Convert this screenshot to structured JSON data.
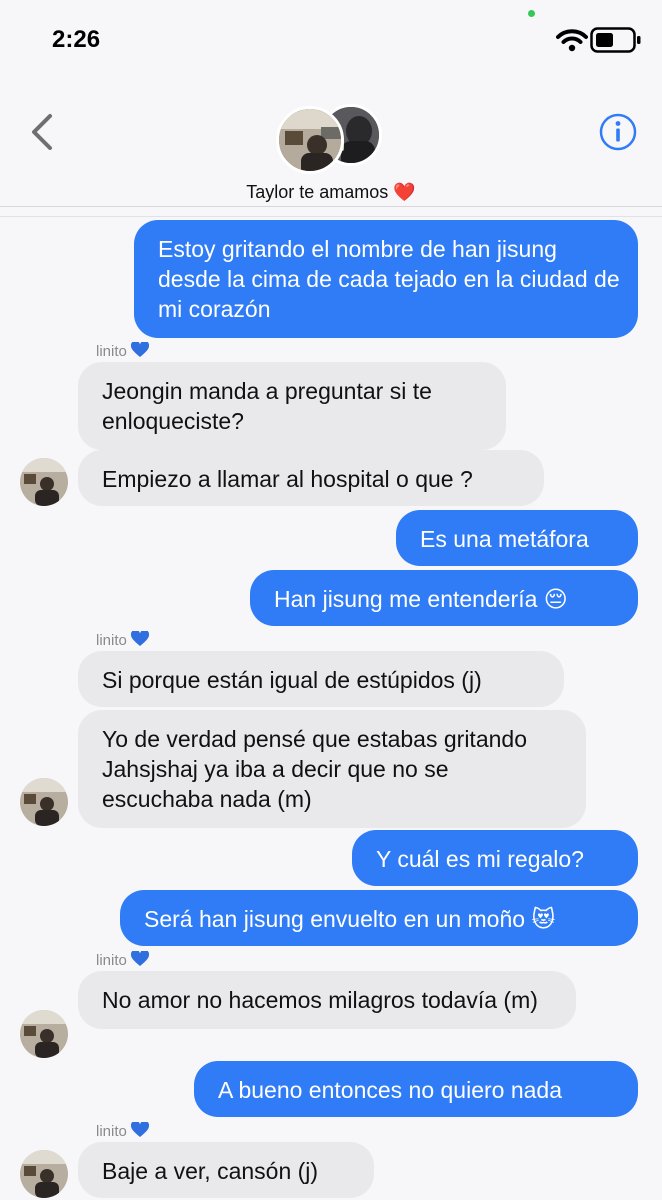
{
  "status_bar": {
    "time": "2:26"
  },
  "header": {
    "contact_name": "Taylor te amamos",
    "contact_emoji": "❤️"
  },
  "messages": [
    {
      "dir": "out",
      "text": "Estoy gritando el nombre de han jisung desde la cima de cada tejado en la ciudad de mi corazón"
    },
    {
      "dir": "sender",
      "text": "linito"
    },
    {
      "dir": "in",
      "text": "Jeongin manda a preguntar si te enloqueciste?"
    },
    {
      "dir": "in",
      "text": "Empiezo a llamar al hospital o que ?"
    },
    {
      "dir": "out",
      "text": "Es una metáfora"
    },
    {
      "dir": "out",
      "text": "Han jisung me entendería 😔"
    },
    {
      "dir": "sender",
      "text": "linito"
    },
    {
      "dir": "in",
      "text": "Si porque están igual de estúpidos (j)"
    },
    {
      "dir": "in",
      "text": "Yo de verdad pensé que estabas gritando Jahsjshaj ya iba a decir que no se escuchaba nada (m)"
    },
    {
      "dir": "out",
      "text": "Y cuál es mi regalo?"
    },
    {
      "dir": "out",
      "text": "Será han jisung envuelto en un moño 😻"
    },
    {
      "dir": "sender",
      "text": "linito"
    },
    {
      "dir": "in",
      "text": "No amor no hacemos milagros todavía (m)"
    },
    {
      "dir": "out",
      "text": "A bueno entonces no quiero nada"
    },
    {
      "dir": "sender",
      "text": "linito"
    },
    {
      "dir": "in",
      "text": "Baje a ver, cansón (j)"
    }
  ],
  "colors": {
    "outgoing": "#2f7cf6",
    "incoming": "#e9e9eb",
    "accent": "#2f7cf6"
  }
}
